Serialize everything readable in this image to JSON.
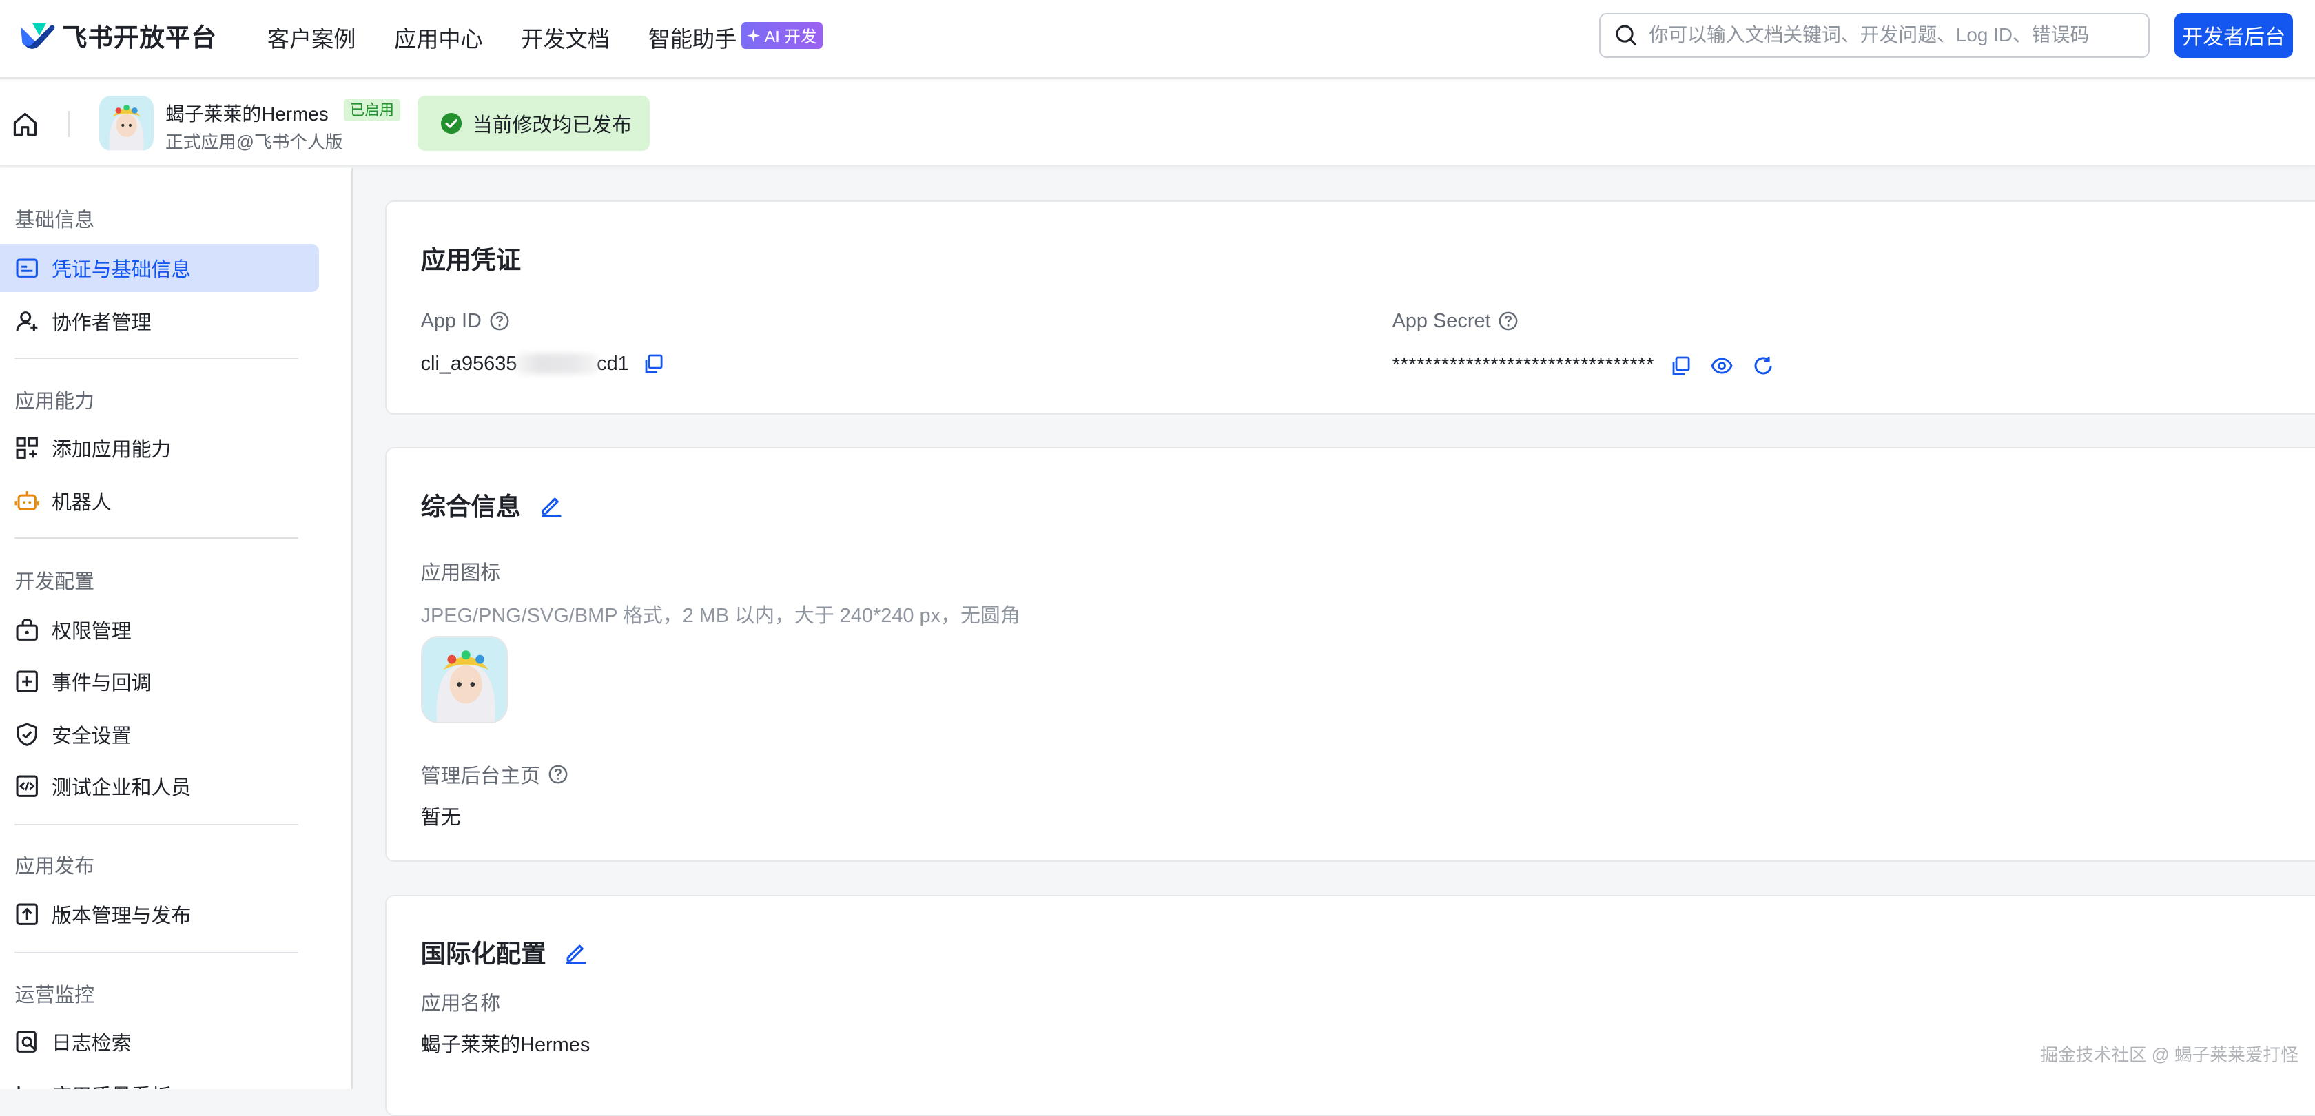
{
  "topnav": {
    "logo_text": "飞书开放平台",
    "items": [
      "客户案例",
      "应用中心",
      "开发文档",
      "智能助手"
    ],
    "ai_badge": "AI 开发",
    "search_placeholder": "你可以输入文档关键词、开发问题、Log ID、错误码",
    "dev_console_label": "开发者后台"
  },
  "app": {
    "name": "蝎子莱莱的Hermes",
    "status": "已启用",
    "subtitle": "正式应用@飞书个人版",
    "publish_notice": "当前修改均已发布"
  },
  "sidebar": {
    "sections": [
      {
        "title": "基础信息",
        "items": [
          {
            "label": "凭证与基础信息",
            "icon": "credential-icon",
            "active": true
          },
          {
            "label": "协作者管理",
            "icon": "user-add-icon",
            "active": false
          }
        ]
      },
      {
        "title": "应用能力",
        "items": [
          {
            "label": "添加应用能力",
            "icon": "apps-add-icon",
            "active": false
          },
          {
            "label": "机器人",
            "icon": "robot-icon",
            "active": false
          }
        ]
      },
      {
        "title": "开发配置",
        "items": [
          {
            "label": "权限管理",
            "icon": "permission-icon",
            "active": false
          },
          {
            "label": "事件与回调",
            "icon": "event-icon",
            "active": false
          },
          {
            "label": "安全设置",
            "icon": "shield-icon",
            "active": false
          },
          {
            "label": "测试企业和人员",
            "icon": "code-icon",
            "active": false
          }
        ]
      },
      {
        "title": "应用发布",
        "items": [
          {
            "label": "版本管理与发布",
            "icon": "upload-icon",
            "active": false
          }
        ]
      },
      {
        "title": "运营监控",
        "items": [
          {
            "label": "日志检索",
            "icon": "log-search-icon",
            "active": false
          },
          {
            "label": "应用质量看板",
            "icon": "chart-icon",
            "active": false
          }
        ]
      }
    ]
  },
  "credentials": {
    "title": "应用凭证",
    "app_id_label": "App ID",
    "app_id_prefix": "cli_a95635",
    "app_id_suffix": "cd1",
    "app_secret_label": "App Secret",
    "app_secret_value": "********************************"
  },
  "general": {
    "title": "综合信息",
    "icon_label": "应用图标",
    "icon_hint": "JPEG/PNG/SVG/BMP 格式，2 MB 以内，大于 240*240 px，无圆角",
    "home_label": "管理后台主页",
    "home_value": "暂无"
  },
  "i18n": {
    "title": "国际化配置",
    "name_label": "应用名称",
    "name_value": "蝎子莱莱的Hermes"
  },
  "watermark": "掘金技术社区 @ 蝎子莱莱爱打怪",
  "colors": {
    "primary": "#1456f0",
    "success_bg": "#d9f5d6",
    "success": "#24912f",
    "active_bg": "#d6e2fd"
  }
}
